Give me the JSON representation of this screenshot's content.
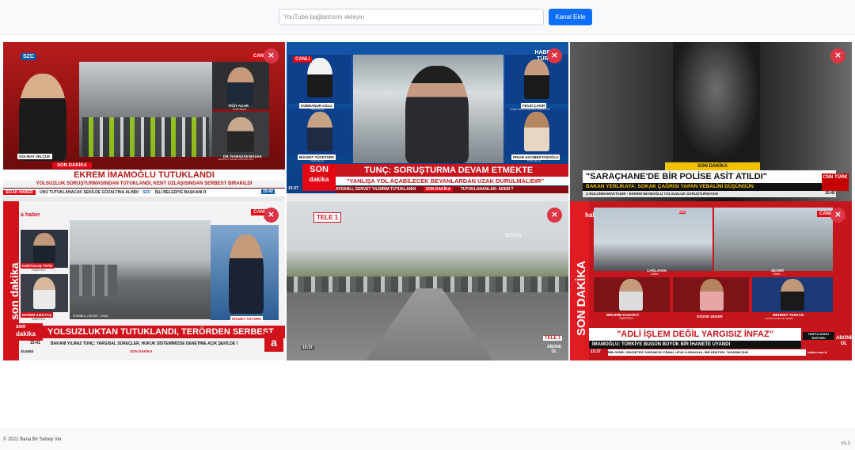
{
  "header": {
    "input_placeholder": "YouTube bağlantısını ekleyin",
    "add_button_label": "Kanal Ekle"
  },
  "close_label": "×",
  "tiles": [
    {
      "brand": "SZC",
      "live": "CANLI",
      "person_left_name": "GÜLİNAY SELÇUK",
      "person_right_top_name": "YİĞİT ACAR",
      "person_right_top_role": "HUKUKÇU",
      "person_right_bottom_name": "DR. RAMAZAN BAŞAK",
      "person_right_bottom_role": "EMNİYET GENEL MÜDÜRLÜĞÜ",
      "breaking": "SON DAKİKA",
      "headline": "EKREM İMAMOĞLU TUTUKLANDI",
      "subline": "YOLSUZLUK SORUŞTURMASINDAN TUTUKLANDI, KENT UZLAŞISINDAN SERBEST BIRAKILDI",
      "ticker_label": "SICAK HABER",
      "ticker": "ÜNÜ TUTUKLANACAK ŞEKİLDE GÖZALTINA ALINDI",
      "ticker_brand": "SZC",
      "ticker_right": "İŞLİ BELEDİYE BAŞKANI R",
      "clock": "15:42"
    },
    {
      "brand": "HABER TÜRK",
      "live": "CANLI",
      "person_1_name": "KÜBRANUR USLU",
      "person_1_role": "HUKUKÇU",
      "person_2_name": "BÜLENT YÜCETÜRK",
      "person_2_role": "HUKUKÇU",
      "person_3_name": "FEVZİ ÇAKIR",
      "person_3_role": "CİNER MEDYA ANKARA TEMSİLCİSİ",
      "person_4_name": "PINAR HACIBEKTAŞOĞLU",
      "person_4_role": "HUKUKÇU",
      "son": "SON",
      "dakika": "dakika",
      "headline": "TUNÇ: SORUŞTURMA DEVAM ETMEKTE",
      "subline": "\"YANLIŞA YOL AÇABİLECEK BEYANLARDAN UZAK DURULMALIDIR\"",
      "ticker": "AYDANLI, SERVET YILDIRIM TUTUKLANDI",
      "ticker_tag": "SON DAKİKA",
      "ticker_right": "TUTUKLANANLAR: ADEM T",
      "clock": "15:37"
    },
    {
      "breaking": "SON DAKİKA",
      "headline": "\"SARAÇHANE'DE BİR POLİSE ASİT ATILDI\"",
      "subline": "BAKAN YERLİKAYA: SOKAK ÇAĞRISI YAPAN VEBALİNİ DÜŞÜNSÜN",
      "ticker": "Ş BULUNMAMAKTADIR   •   EKREM İMAMOĞLU YOLSUZLUK SORUŞTURMASIN",
      "brand": "CNN TÜRK",
      "clock": "15:42"
    },
    {
      "brand": "a haber",
      "live": "CANLI",
      "side_text": "son dakika",
      "person_1_name": "KURTULUŞ TAYİZ",
      "person_1_role": "GAZETECİ",
      "person_2_name": "EKREM KIZILTAŞ",
      "person_2_role": "GAZETECİ",
      "location": "İSTANBUL | SİLİVRİ - CANLI",
      "person_3_name": "HİKMET ÖZTÜRK",
      "son": "son",
      "dakika": "dakika",
      "headline": "YOLSUZLUKTAN TUTUKLANDI, TERÖRDEN SERBEST",
      "ticker": "BAKANI YILMAZ TUNÇ: YARGISAL SÜREÇLER, HUKUK SİSTEMİMİZDE DENETİME AÇIK ŞEKİLDE İ",
      "ticker_tag": "SON DAKİKA",
      "clock": "15:41",
      "bist": "40,9483"
    },
    {
      "brand": "TELE 1",
      "watermark": "anka",
      "corner_brand": "TELE 1",
      "corner_sub": "ABONE OL",
      "clock": "15:37"
    },
    {
      "brand": "halk tv",
      "live": "CANLI",
      "side_text": "SON DAKİKA",
      "dha": "DHA",
      "loc_1": "ÇAĞLAYAN",
      "loc_1_sub": "CANLI",
      "loc_2": "SİLİVRİ",
      "loc_2_sub": "CANLI",
      "person_1_name": "İBRAHİM KAHVECİ",
      "person_1_role": "GAZETECİ",
      "person_2_name": "GÖZDE ŞEKER",
      "person_3_name": "MEHMET TEZKAN",
      "person_3_role": "HALKTV.COM.TR YAZARI",
      "report_tag": "HAFTA SONU RAPORU",
      "headline": "\"ADLİ İŞLEM DEĞİL YARGISIZ İNFAZ\"",
      "subline": "İMAMOĞLU: TÜRKİYE BUGÜN BÜYÜK BİR İHANETE UYANDI",
      "ticker": "İBB GENEL SEKRETER YARDIMCISI CEMAL UFUK KARAKAYA, İBB KENTSEL TASARIM ŞUB",
      "ticker_site": "halktv.com.tr",
      "abone": "ABONE OL",
      "clock": "15:37"
    }
  ],
  "footer": {
    "copyright": "© 2021 Bana Bir Sebep Ver",
    "version": "v1.1"
  },
  "colors": {
    "primary": "#0d6efd",
    "danger": "#dc3545",
    "news_red": "#d1121b",
    "cnn_yellow": "#f2c200"
  }
}
